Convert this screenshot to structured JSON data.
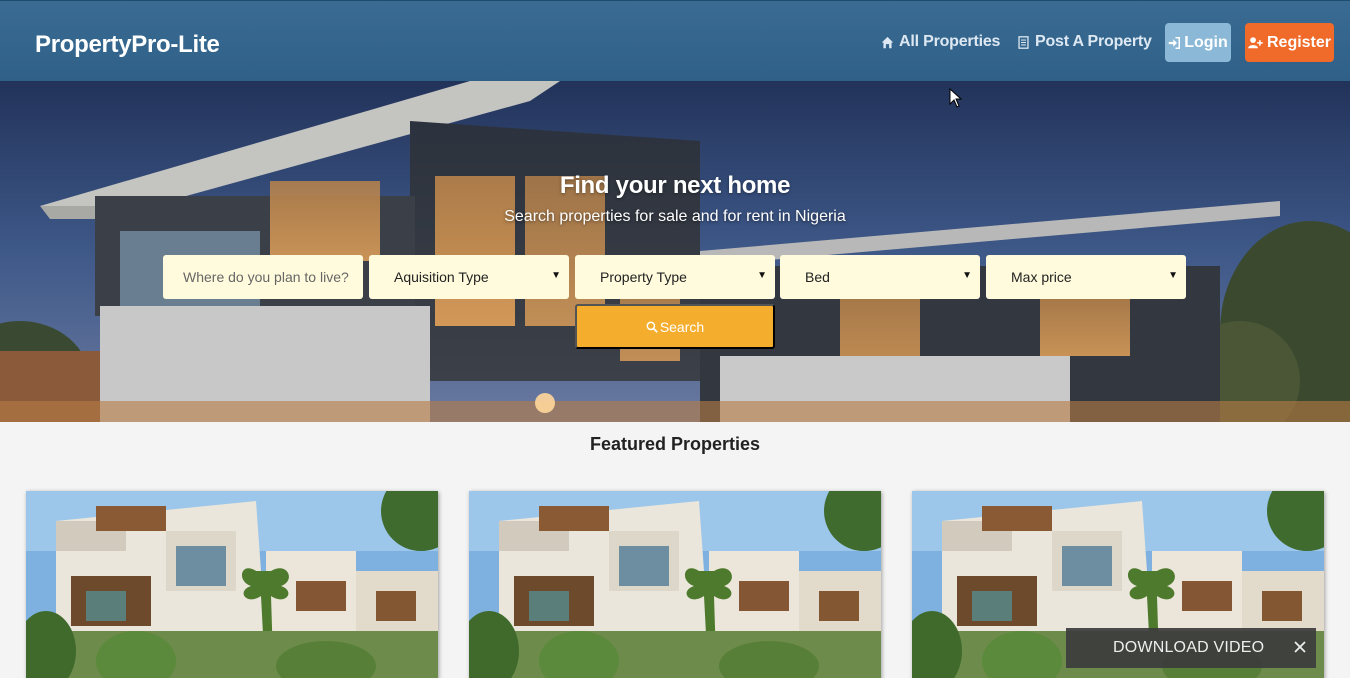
{
  "navbar": {
    "brand": "PropertyPro-Lite",
    "all_properties": "All Properties",
    "post_property": "Post A Property",
    "login": "Login",
    "register": "Register",
    "icons": {
      "all_properties": "home-icon",
      "post_property": "document-icon",
      "login": "sign-in-icon",
      "register": "user-plus-icon"
    }
  },
  "hero": {
    "title": "Find your next home",
    "subtitle": "Search properties for sale and for rent in Nigeria",
    "location_placeholder": "Where do you plan to live?",
    "acquisition_type": "Aquisition Type",
    "property_type": "Property Type",
    "bed": "Bed",
    "max_price": "Max price",
    "search_label": "Search"
  },
  "featured": {
    "title": "Featured Properties",
    "cards": [
      {
        "image": "property-photo"
      },
      {
        "image": "property-photo"
      },
      {
        "image": "property-photo"
      }
    ]
  },
  "overlay": {
    "download_video": "DOWNLOAD VIDEO"
  },
  "colors": {
    "navbar": "#33658d",
    "login_button": "#8ab8d6",
    "register_button": "#f06a2a",
    "field_background": "#fffbdc",
    "search_button": "#f4ad2d",
    "page_background": "#f4f4f4"
  }
}
